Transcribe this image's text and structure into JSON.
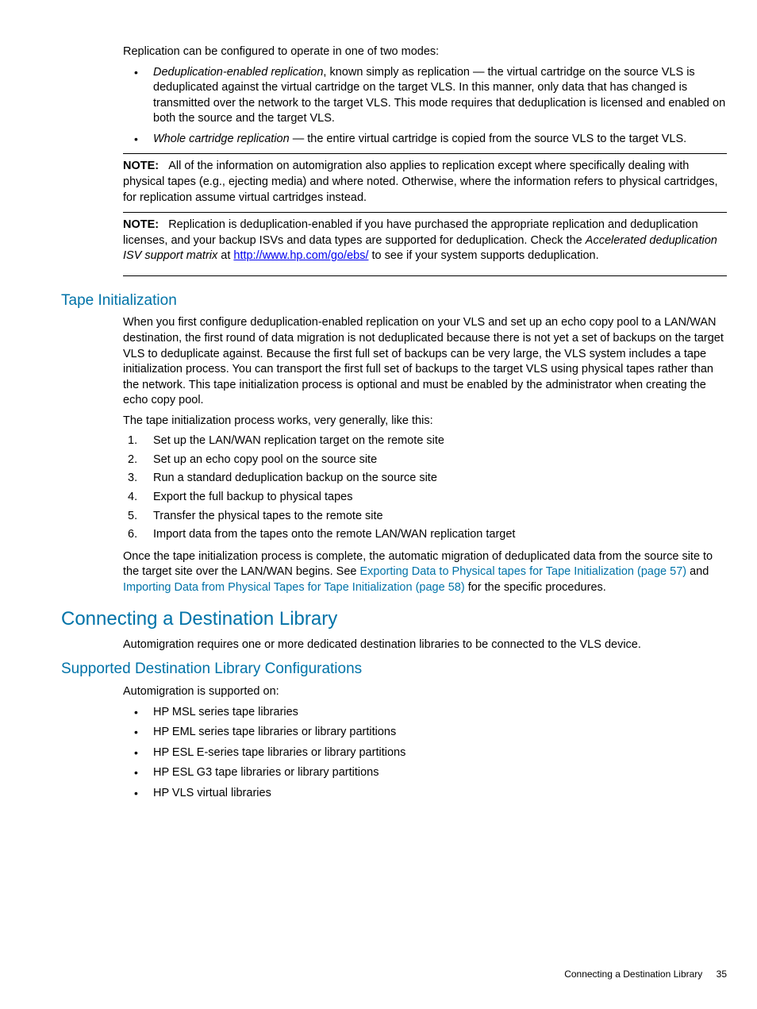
{
  "intro": "Replication can be configured to operate in one of two modes:",
  "modes": [
    {
      "term": "Deduplication-enabled replication",
      "rest": ", known simply as replication — the virtual cartridge on the source VLS is deduplicated against the virtual cartridge on the target VLS. In this manner, only data that has changed is transmitted over the network to the target VLS. This mode requires that deduplication is licensed and enabled on both the source and the target VLS."
    },
    {
      "term": "Whole cartridge replication",
      "rest": " — the entire virtual cartridge is copied from the source VLS to the target VLS."
    }
  ],
  "note1": {
    "label": "NOTE:",
    "text": "All of the information on automigration also applies to replication except where specifically dealing with physical tapes (e.g., ejecting media) and where noted. Otherwise, where the information refers to physical cartridges, for replication assume virtual cartridges instead."
  },
  "note2": {
    "label": "NOTE:",
    "pre": "Replication is deduplication-enabled if you have purchased the appropriate replication and deduplication licenses, and your backup ISVs and data types are supported for deduplication. Check the ",
    "italic": "Accelerated deduplication ISV support matrix",
    "mid": " at ",
    "link": "http://www.hp.com/go/ebs/",
    "post": " to see if your system supports deduplication."
  },
  "tapeInit": {
    "heading": "Tape Initialization",
    "p1": "When you first configure deduplication-enabled replication on your VLS and set up an echo copy pool to a LAN/WAN destination, the first round of data migration is not deduplicated because there is not yet a set of backups on the target VLS to deduplicate against. Because the first full set of backups can be very large, the VLS system includes a tape initialization process. You can transport the first full set of backups to the target VLS using physical tapes rather than the network. This tape initialization process is optional and must be enabled by the administrator when creating the echo copy pool.",
    "p2": "The tape initialization process works, very generally, like this:",
    "steps": [
      "Set up the LAN/WAN replication target on the remote site",
      "Set up an echo copy pool on the source site",
      "Run a standard deduplication backup on the source site",
      "Export the full backup to physical tapes",
      "Transfer the physical tapes to the remote site",
      "Import data from the tapes onto the remote LAN/WAN replication target"
    ],
    "p3pre": "Once the tape initialization process is complete, the automatic migration of deduplicated data from the source site to the target site over the LAN/WAN begins. See ",
    "link1": "Exporting Data to Physical tapes for Tape Initialization (page 57)",
    "p3mid": " and ",
    "link2": "Importing Data from Physical Tapes for Tape Initialization (page 58)",
    "p3post": " for the specific procedures."
  },
  "connLib": {
    "heading": "Connecting a Destination Library",
    "p1": "Automigration requires one or more dedicated destination libraries to be connected to the VLS device."
  },
  "supported": {
    "heading": "Supported Destination Library Configurations",
    "intro": "Automigration is supported on:",
    "items": [
      "HP MSL series tape libraries",
      "HP EML series tape libraries or library partitions",
      "HP ESL E-series tape libraries or library partitions",
      "HP ESL G3 tape libraries or library partitions",
      "HP VLS virtual libraries"
    ]
  },
  "footer": {
    "title": "Connecting a Destination Library",
    "page": "35"
  }
}
